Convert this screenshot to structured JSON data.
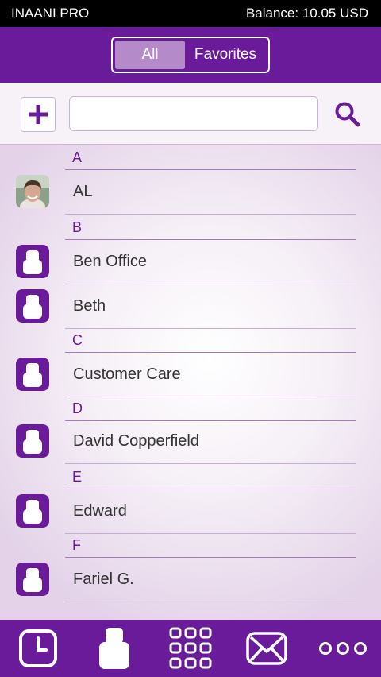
{
  "status_bar": {
    "app_name": "INAANI PRO",
    "balance": "Balance: 10.05 USD"
  },
  "header": {
    "tabs": [
      {
        "label": "All",
        "selected": true
      },
      {
        "label": "Favorites",
        "selected": false
      }
    ]
  },
  "search": {
    "value": "",
    "placeholder": "",
    "add_icon": "plus-icon",
    "search_icon": "search-icon"
  },
  "contacts": {
    "sections": [
      {
        "letter": "A",
        "contacts": [
          {
            "name": "AL",
            "avatar": "photo"
          }
        ]
      },
      {
        "letter": "B",
        "contacts": [
          {
            "name": "Ben Office",
            "avatar": "person-icon"
          },
          {
            "name": "Beth",
            "avatar": "person-icon"
          }
        ]
      },
      {
        "letter": "C",
        "contacts": [
          {
            "name": "Customer Care",
            "avatar": "person-icon"
          }
        ]
      },
      {
        "letter": "D",
        "contacts": [
          {
            "name": "David Copperfield",
            "avatar": "person-icon"
          }
        ]
      },
      {
        "letter": "E",
        "contacts": [
          {
            "name": "Edward",
            "avatar": "person-icon"
          }
        ]
      },
      {
        "letter": "F",
        "contacts": [
          {
            "name": "Fariel G.",
            "avatar": "person-icon"
          }
        ]
      }
    ]
  },
  "bottom_nav": {
    "items": [
      {
        "icon": "clock-icon",
        "active": false
      },
      {
        "icon": "person-icon",
        "active": true
      },
      {
        "icon": "dialpad-icon",
        "active": false
      },
      {
        "icon": "envelope-icon",
        "active": false
      },
      {
        "icon": "more-icon",
        "active": false
      }
    ]
  },
  "colors": {
    "brand_purple": "#6a1b9a",
    "selected_tab": "#b58ac9",
    "section_text": "#6a1b9a"
  }
}
